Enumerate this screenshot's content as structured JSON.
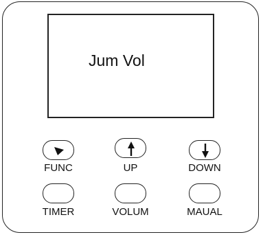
{
  "display": {
    "text": "Jum Vol"
  },
  "buttons": {
    "func": {
      "label": "FUNC",
      "icon": "triangle-down-icon"
    },
    "up": {
      "label": "UP",
      "icon": "arrow-up-icon"
    },
    "down": {
      "label": "DOWN",
      "icon": "arrow-down-icon"
    },
    "timer": {
      "label": "TIMER"
    },
    "volum": {
      "label": "VOLUM"
    },
    "maual": {
      "label": "MAUAL"
    }
  }
}
